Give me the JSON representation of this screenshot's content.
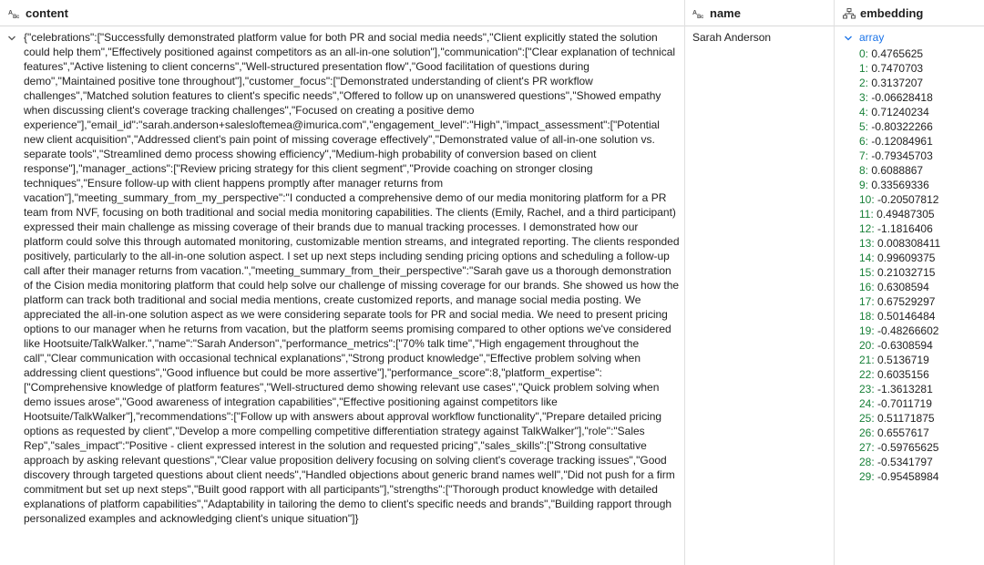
{
  "columns": [
    {
      "label": "content",
      "type_icon": "abc-text-icon"
    },
    {
      "label": "name",
      "type_icon": "abc-text-icon"
    },
    {
      "label": "embedding",
      "type_icon": "tree-structure-icon"
    }
  ],
  "row": {
    "content": "{\"celebrations\":[\"Successfully demonstrated platform value for both PR and social media needs\",\"Client explicitly stated the solution could help them\",\"Effectively positioned against competitors as an all-in-one solution\"],\"communication\":[\"Clear explanation of technical features\",\"Active listening to client concerns\",\"Well-structured presentation flow\",\"Good facilitation of questions during demo\",\"Maintained positive tone throughout\"],\"customer_focus\":[\"Demonstrated understanding of client's PR workflow challenges\",\"Matched solution features to client's specific needs\",\"Offered to follow up on unanswered questions\",\"Showed empathy when discussing client's coverage tracking challenges\",\"Focused on creating a positive demo experience\"],\"email_id\":\"sarah.anderson+salesloftemea@imurica.com\",\"engagement_level\":\"High\",\"impact_assessment\":[\"Potential new client acquisition\",\"Addressed client's pain point of missing coverage effectively\",\"Demonstrated value of all-in-one solution vs. separate tools\",\"Streamlined demo process showing efficiency\",\"Medium-high probability of conversion based on client response\"],\"manager_actions\":[\"Review pricing strategy for this client segment\",\"Provide coaching on stronger closing techniques\",\"Ensure follow-up with client happens promptly after manager returns from vacation\"],\"meeting_summary_from_my_perspective\":\"I conducted a comprehensive demo of our media monitoring platform for a PR team from NVF, focusing on both traditional and social media monitoring capabilities. The clients (Emily, Rachel, and a third participant) expressed their main challenge as missing coverage of their brands due to manual tracking processes. I demonstrated how our platform could solve this through automated monitoring, customizable mention streams, and integrated reporting. The clients responded positively, particularly to the all-in-one solution aspect. I set up next steps including sending pricing options and scheduling a follow-up call after their manager returns from vacation.\",\"meeting_summary_from_their_perspective\":\"Sarah gave us a thorough demonstration of the Cision media monitoring platform that could help solve our challenge of missing coverage for our brands. She showed us how the platform can track both traditional and social media mentions, create customized reports, and manage social media posting. We appreciated the all-in-one solution aspect as we were considering separate tools for PR and social media. We need to present pricing options to our manager when he returns from vacation, but the platform seems promising compared to other options we've considered like Hootsuite/TalkWalker.\",\"name\":\"Sarah Anderson\",\"performance_metrics\":[\"70% talk time\",\"High engagement throughout the call\",\"Clear communication with occasional technical explanations\",\"Strong product knowledge\",\"Effective problem solving when addressing client questions\",\"Good influence but could be more assertive\"],\"performance_score\":8,\"platform_expertise\":[\"Comprehensive knowledge of platform features\",\"Well-structured demo showing relevant use cases\",\"Quick problem solving when demo issues arose\",\"Good awareness of integration capabilities\",\"Effective positioning against competitors like Hootsuite/TalkWalker\"],\"recommendations\":[\"Follow up with answers about approval workflow functionality\",\"Prepare detailed pricing options as requested by client\",\"Develop a more compelling competitive differentiation strategy against TalkWalker\"],\"role\":\"Sales Rep\",\"sales_impact\":\"Positive - client expressed interest in the solution and requested pricing\",\"sales_skills\":[\"Strong consultative approach by asking relevant questions\",\"Clear value proposition delivery focusing on solving client's coverage tracking issues\",\"Good discovery through targeted questions about client needs\",\"Handled objections about generic brand names well\",\"Did not push for a firm commitment but set up next steps\",\"Built good rapport with all participants\"],\"strengths\":[\"Thorough product knowledge with detailed explanations of platform capabilities\",\"Adaptability in tailoring the demo to client's specific needs and brands\",\"Building rapport through personalized examples and acknowledging client's unique situation\"]}",
    "name": "Sarah Anderson",
    "embedding_label": "array",
    "embedding": [
      {
        "idx": "0:",
        "val": "0.4765625"
      },
      {
        "idx": "1:",
        "val": "0.7470703"
      },
      {
        "idx": "2:",
        "val": "0.3137207"
      },
      {
        "idx": "3:",
        "val": "-0.06628418"
      },
      {
        "idx": "4:",
        "val": "0.71240234"
      },
      {
        "idx": "5:",
        "val": "-0.80322266"
      },
      {
        "idx": "6:",
        "val": "-0.12084961"
      },
      {
        "idx": "7:",
        "val": "-0.79345703"
      },
      {
        "idx": "8:",
        "val": "0.6088867"
      },
      {
        "idx": "9:",
        "val": "0.33569336"
      },
      {
        "idx": "10:",
        "val": "-0.20507812"
      },
      {
        "idx": "11:",
        "val": "0.49487305"
      },
      {
        "idx": "12:",
        "val": "-1.1816406"
      },
      {
        "idx": "13:",
        "val": "0.008308411"
      },
      {
        "idx": "14:",
        "val": "0.99609375"
      },
      {
        "idx": "15:",
        "val": "0.21032715"
      },
      {
        "idx": "16:",
        "val": "0.6308594"
      },
      {
        "idx": "17:",
        "val": "0.67529297"
      },
      {
        "idx": "18:",
        "val": "0.50146484"
      },
      {
        "idx": "19:",
        "val": "-0.48266602"
      },
      {
        "idx": "20:",
        "val": "-0.6308594"
      },
      {
        "idx": "21:",
        "val": "0.5136719"
      },
      {
        "idx": "22:",
        "val": "0.6035156"
      },
      {
        "idx": "23:",
        "val": "-1.3613281"
      },
      {
        "idx": "24:",
        "val": "-0.7011719"
      },
      {
        "idx": "25:",
        "val": "0.51171875"
      },
      {
        "idx": "26:",
        "val": "0.6557617"
      },
      {
        "idx": "27:",
        "val": "-0.59765625"
      },
      {
        "idx": "28:",
        "val": "-0.5341797"
      },
      {
        "idx": "29:",
        "val": "-0.95458984"
      }
    ]
  }
}
